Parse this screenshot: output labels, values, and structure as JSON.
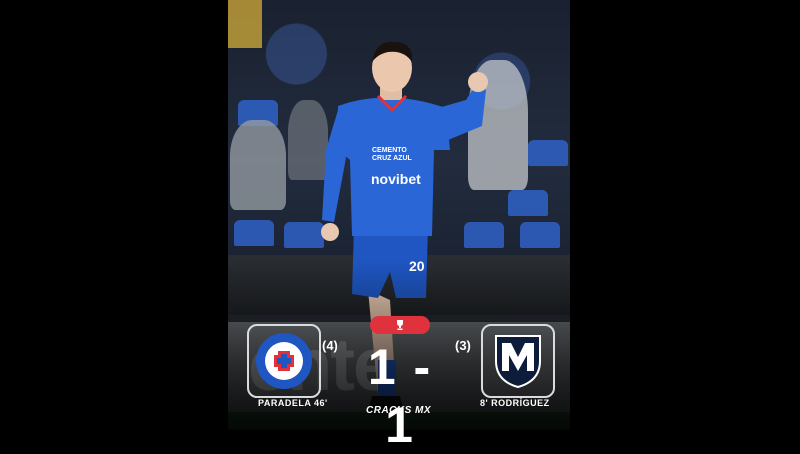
{
  "match": {
    "home_penalties": "(4)",
    "away_penalties": "(3)",
    "score": "1 - 1",
    "home_scorer": "PARADELA 46'",
    "away_scorer": "8' RODRÍGUEZ"
  },
  "player": {
    "sponsor": "novibet",
    "shirt_text": "CEMENTO CRUZ AZUL",
    "number": "20"
  },
  "home_crest": {
    "ring_text": "CLUB DE FUTBOL CRUZ AZUL"
  },
  "background": {
    "ad_text": "ente"
  },
  "brand": {
    "name": "CRACKS MX"
  },
  "colors": {
    "cruz_blue": "#1f56c2",
    "pill_red": "#e0323c"
  }
}
